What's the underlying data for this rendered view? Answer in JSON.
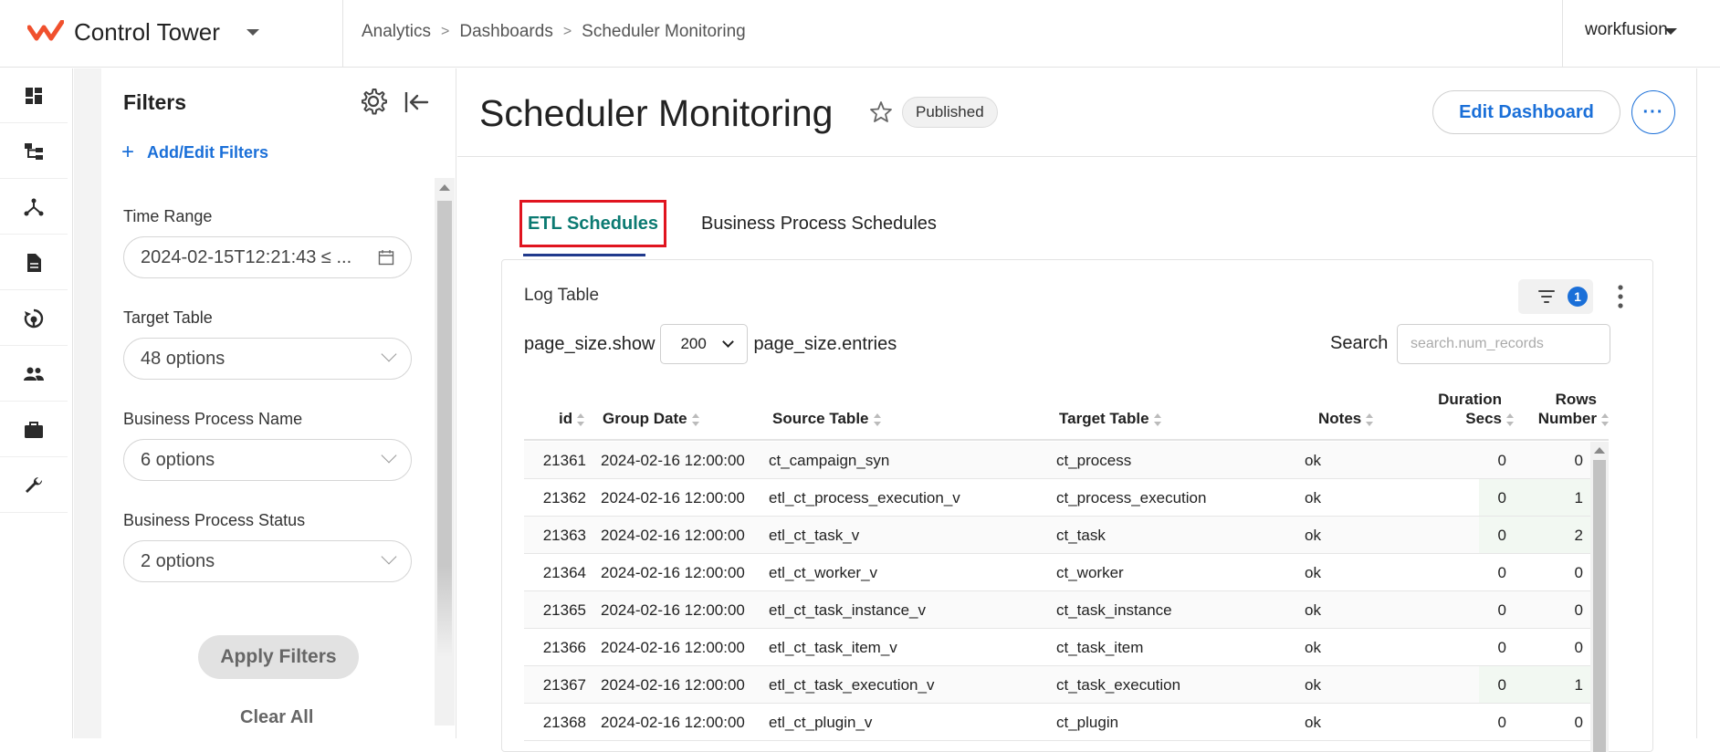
{
  "app": {
    "title": "Control Tower",
    "user": "workfusion",
    "brand_color": "#f0502d"
  },
  "breadcrumb": [
    "Analytics",
    "Dashboards",
    "Scheduler Monitoring"
  ],
  "rail": [
    {
      "name": "dashboard-icon"
    },
    {
      "name": "hierarchy-icon"
    },
    {
      "name": "network-icon"
    },
    {
      "name": "document-icon"
    },
    {
      "name": "cycle-icon"
    },
    {
      "name": "users-icon"
    },
    {
      "name": "briefcase-icon"
    },
    {
      "name": "wrench-icon"
    }
  ],
  "filters": {
    "title": "Filters",
    "add_label": "Add/Edit Filters",
    "fields": [
      {
        "label": "Time Range",
        "value": "2024-02-15T12:21:43 ≤ ..."
      },
      {
        "label": "Target Table",
        "value": "48 options"
      },
      {
        "label": "Business Process Name",
        "value": "6 options"
      },
      {
        "label": "Business Process Status",
        "value": "2 options"
      }
    ],
    "apply_label": "Apply Filters",
    "clear_label": "Clear All"
  },
  "dashboard": {
    "title": "Scheduler Monitoring",
    "status": "Published",
    "edit_label": "Edit Dashboard",
    "more_label": "···"
  },
  "tabs": [
    {
      "label": "ETL Schedules",
      "active": true
    },
    {
      "label": "Business Process Schedules",
      "active": false
    }
  ],
  "table": {
    "title": "Log Table",
    "filter_count": "1",
    "page_size_show": "page_size.show",
    "page_size_value": "200",
    "page_size_entries": "page_size.entries",
    "search_label": "Search",
    "search_placeholder": "search.num_records",
    "columns": {
      "id": "id",
      "group_date": "Group Date",
      "source_table": "Source Table",
      "target_table": "Target Table",
      "notes": "Notes",
      "duration_1": "Duration",
      "duration_2": "Secs",
      "rows_1": "Rows",
      "rows_2": "Number"
    },
    "rows": [
      {
        "id": "21361",
        "date": "2024-02-16 12:00:00",
        "source": "ct_campaign_syn",
        "target": "ct_process",
        "notes": "ok",
        "duration": "0",
        "rows": "0"
      },
      {
        "id": "21362",
        "date": "2024-02-16 12:00:00",
        "source": "etl_ct_process_execution_v",
        "target": "ct_process_execution",
        "notes": "ok",
        "duration": "0",
        "rows": "1"
      },
      {
        "id": "21363",
        "date": "2024-02-16 12:00:00",
        "source": "etl_ct_task_v",
        "target": "ct_task",
        "notes": "ok",
        "duration": "0",
        "rows": "2"
      },
      {
        "id": "21364",
        "date": "2024-02-16 12:00:00",
        "source": "etl_ct_worker_v",
        "target": "ct_worker",
        "notes": "ok",
        "duration": "0",
        "rows": "0"
      },
      {
        "id": "21365",
        "date": "2024-02-16 12:00:00",
        "source": "etl_ct_task_instance_v",
        "target": "ct_task_instance",
        "notes": "ok",
        "duration": "0",
        "rows": "0"
      },
      {
        "id": "21366",
        "date": "2024-02-16 12:00:00",
        "source": "etl_ct_task_item_v",
        "target": "ct_task_item",
        "notes": "ok",
        "duration": "0",
        "rows": "0"
      },
      {
        "id": "21367",
        "date": "2024-02-16 12:00:00",
        "source": "etl_ct_task_execution_v",
        "target": "ct_task_execution",
        "notes": "ok",
        "duration": "0",
        "rows": "1"
      },
      {
        "id": "21368",
        "date": "2024-02-16 12:00:00",
        "source": "etl_ct_plugin_v",
        "target": "ct_plugin",
        "notes": "ok",
        "duration": "0",
        "rows": "0"
      }
    ]
  },
  "colors": {
    "accent": "#1a6fd8",
    "active_tab": "#0b7a72",
    "highlight_box": "#e0141f"
  }
}
